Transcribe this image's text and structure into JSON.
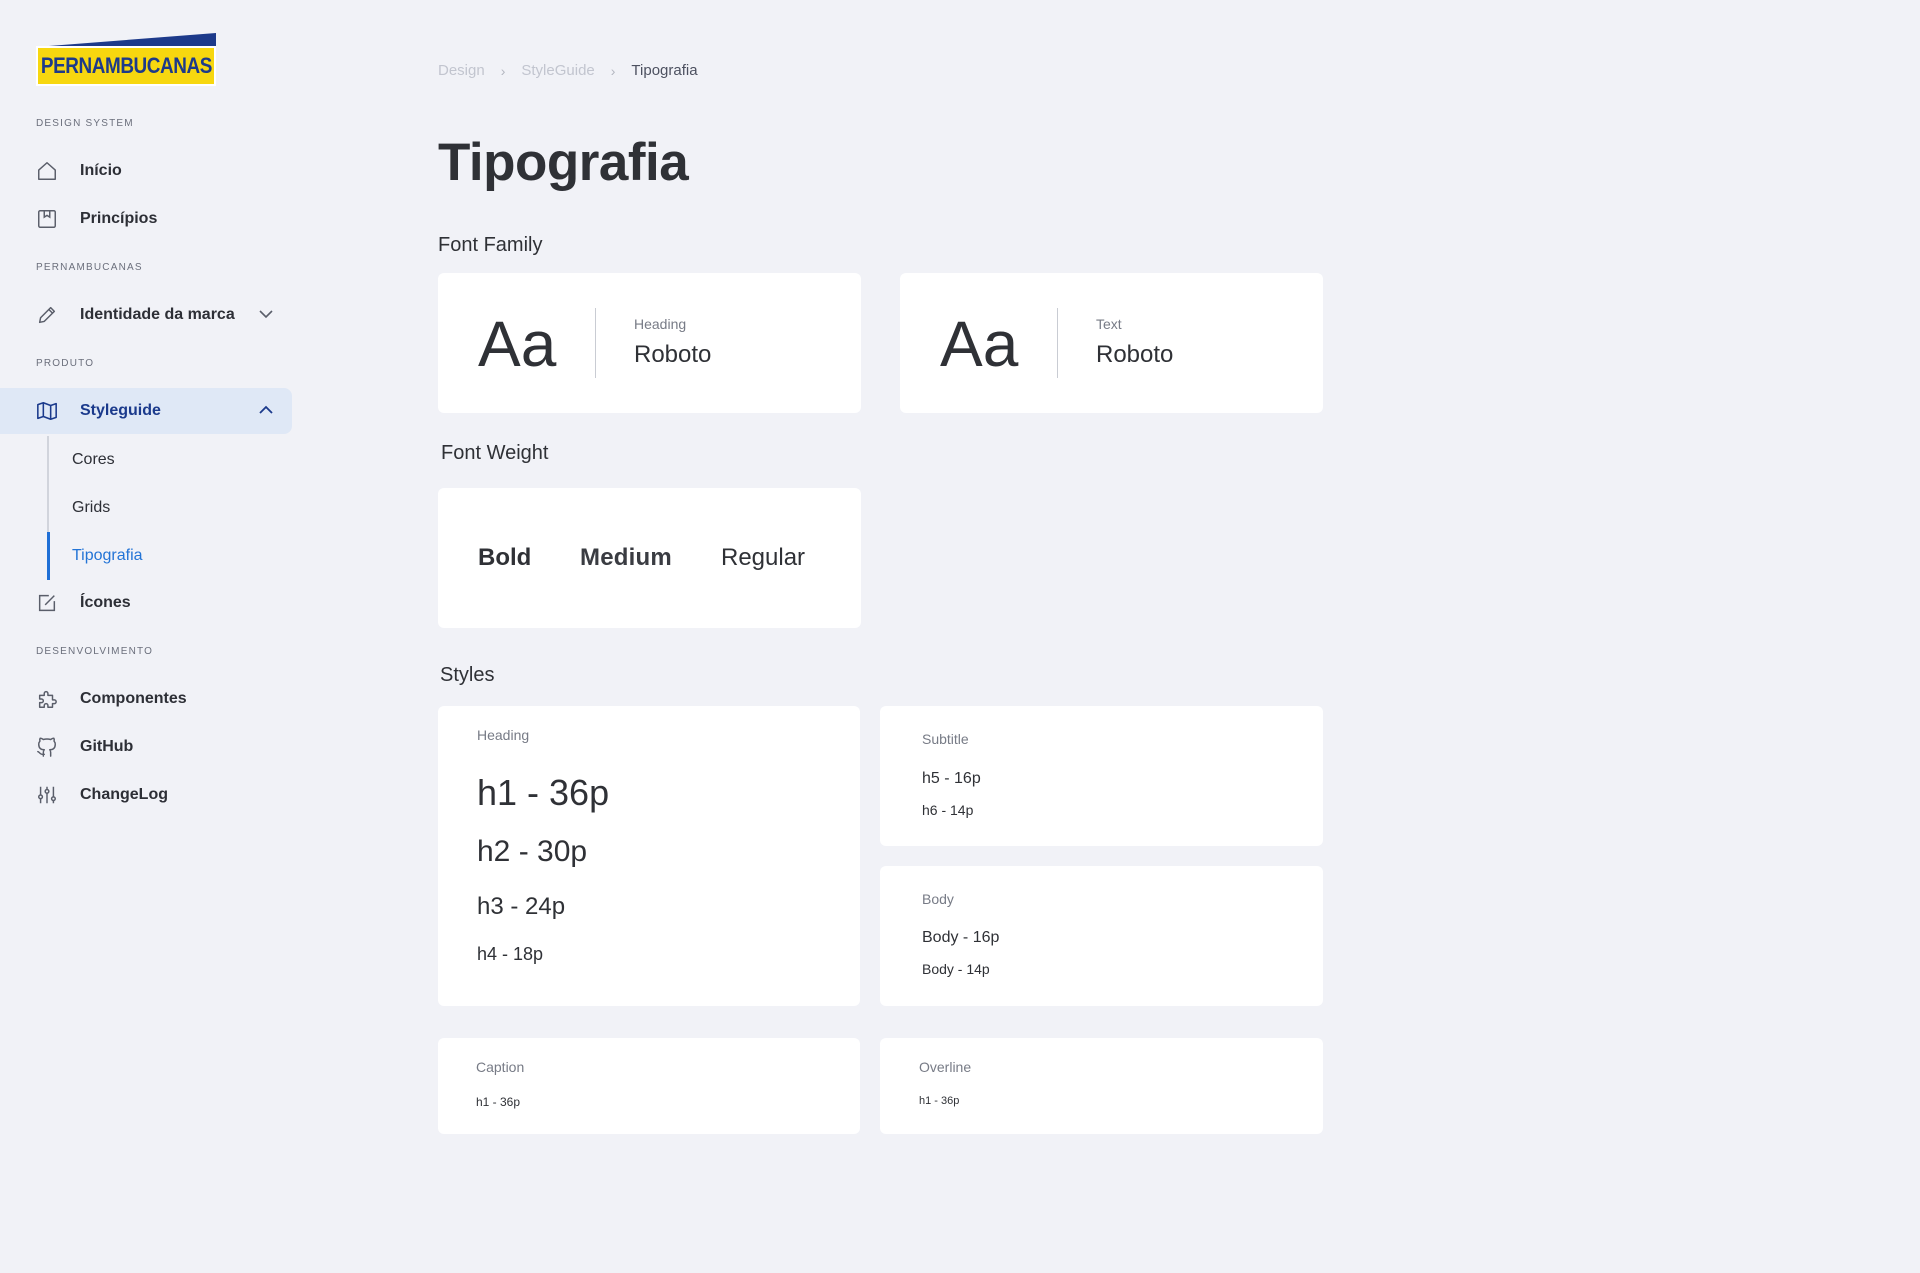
{
  "brand": {
    "logo_text": "PERNAMBUCANAS",
    "primary": "#1d3a8a",
    "yellow": "#f7d70f",
    "accent": "#2374d6"
  },
  "sidebar": {
    "sections": [
      {
        "label": "DESIGN SYSTEM"
      },
      {
        "label": "PERNAMBUCANAS"
      },
      {
        "label": "PRODUTO"
      },
      {
        "label": "DESENVOLVIMENTO"
      }
    ],
    "items": [
      {
        "label": "Início",
        "icon": "home-icon"
      },
      {
        "label": "Princípios",
        "icon": "bookmark-book-icon"
      },
      {
        "label": "Identidade da marca",
        "icon": "pencil-icon"
      },
      {
        "label": "Styleguide",
        "icon": "map-icon"
      },
      {
        "label": "Ícones",
        "icon": "edit-square-icon"
      },
      {
        "label": "Componentes",
        "icon": "puzzle-icon"
      },
      {
        "label": "GitHub",
        "icon": "github-icon"
      },
      {
        "label": "ChangeLog",
        "icon": "sliders-icon"
      }
    ],
    "sub_items": [
      {
        "label": "Cores"
      },
      {
        "label": "Grids"
      },
      {
        "label": "Tipografia"
      }
    ]
  },
  "breadcrumb": [
    "Design",
    "StyleGuide",
    "Tipografia"
  ],
  "page_title": "Tipografia",
  "font_family": {
    "title": "Font Family",
    "cards": [
      {
        "sample": "Aa",
        "caption": "Heading",
        "font": "Roboto"
      },
      {
        "sample": "Aa",
        "caption": "Text",
        "font": "Roboto"
      }
    ]
  },
  "font_weight": {
    "title": "Font Weight",
    "weights": [
      "Bold",
      "Medium",
      "Regular"
    ]
  },
  "styles": {
    "title": "Styles",
    "heading": {
      "caption": "Heading",
      "lines": [
        "h1 - 36p",
        "h2 - 30p",
        "h3 - 24p",
        "h4 - 18p"
      ]
    },
    "subtitle": {
      "caption": "Subtitle",
      "lines": [
        "h5 - 16p",
        "h6 - 14p"
      ]
    },
    "body": {
      "caption": "Body",
      "lines": [
        "Body - 16p",
        "Body - 14p"
      ]
    },
    "caption": {
      "caption": "Caption",
      "lines": [
        "h1 - 36p"
      ]
    },
    "overline": {
      "caption": "Overline",
      "lines": [
        "h1 - 36p"
      ]
    }
  }
}
